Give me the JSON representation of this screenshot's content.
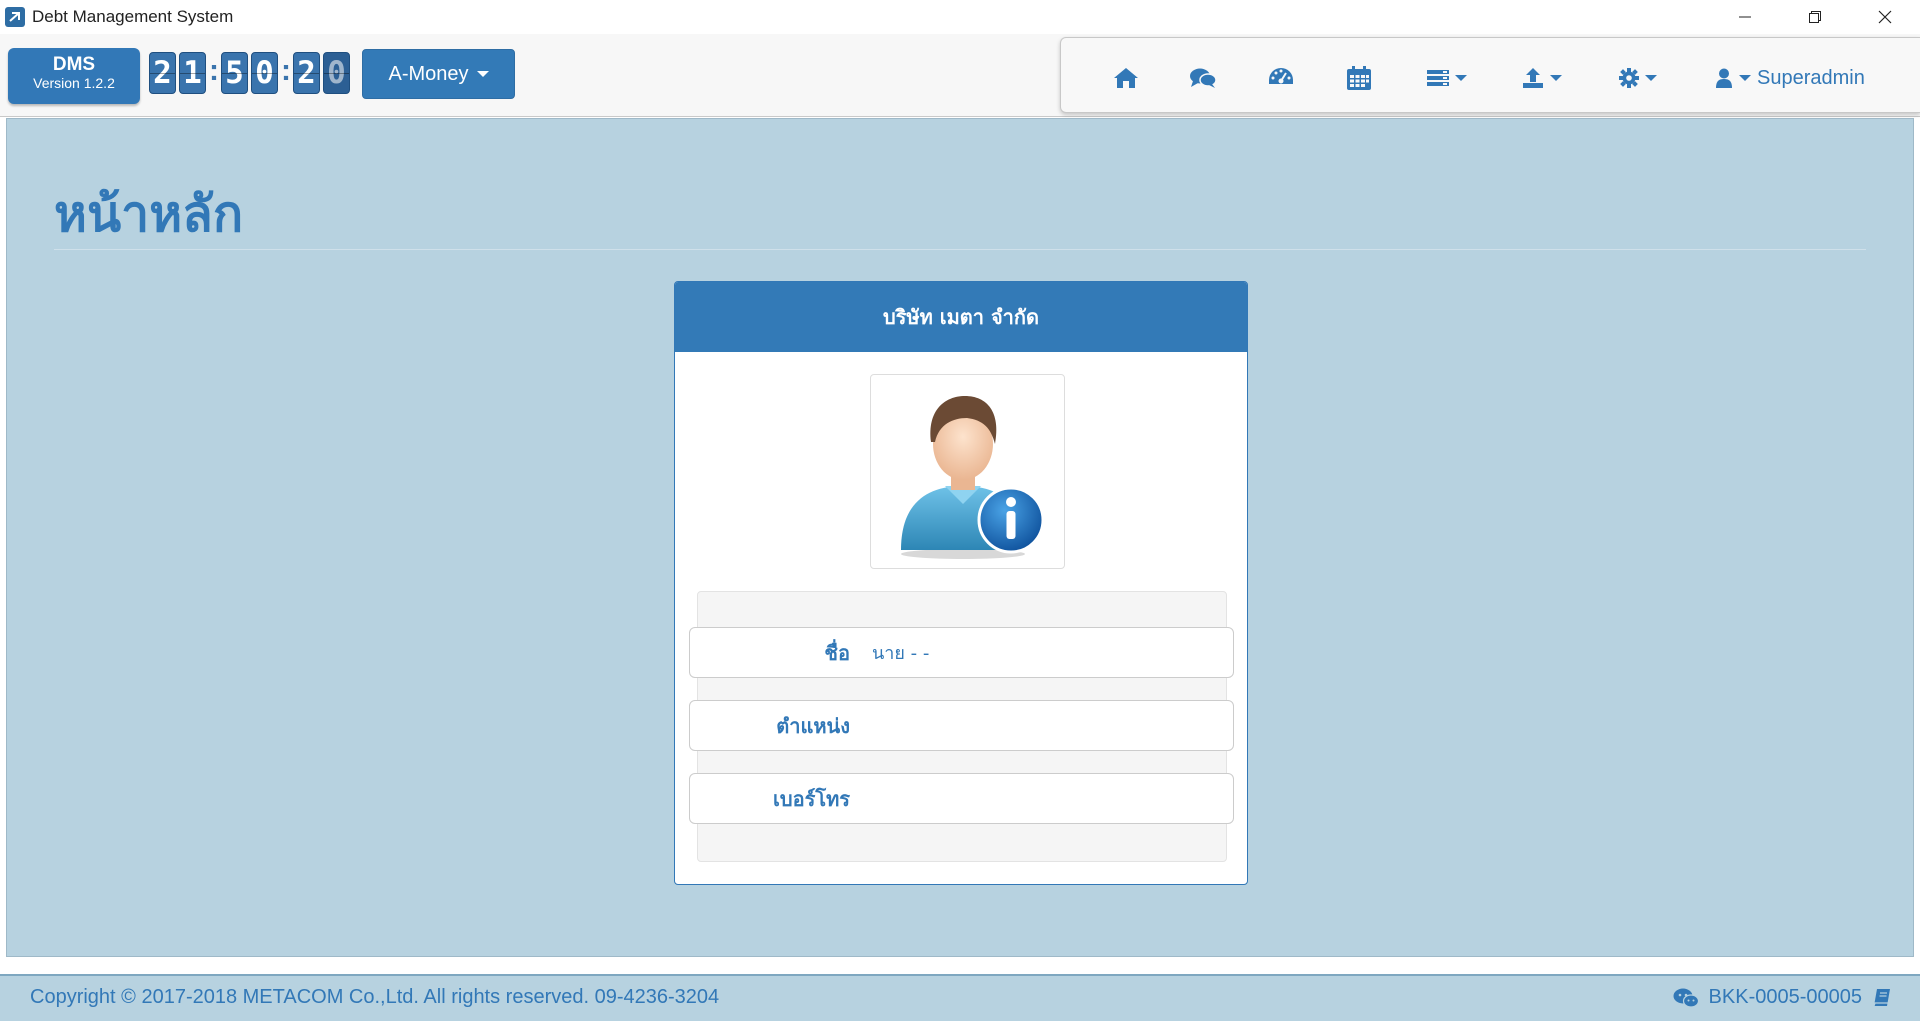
{
  "window": {
    "title": "Debt Management System",
    "controls": [
      "minimize-icon",
      "restore-icon",
      "close-icon"
    ]
  },
  "brand": {
    "name": "DMS",
    "version": "Version 1.2.2"
  },
  "clock": {
    "digits": [
      "2",
      "1",
      "5",
      "0",
      "2",
      "0"
    ],
    "display": "21:50:20"
  },
  "company_menu": {
    "label": "A-Money"
  },
  "nav": {
    "items": [
      {
        "icon": "home-icon"
      },
      {
        "icon": "chat-icon"
      },
      {
        "icon": "dashboard-icon"
      },
      {
        "icon": "calendar-icon"
      },
      {
        "icon": "list-icon",
        "dropdown": true
      },
      {
        "icon": "upload-icon",
        "dropdown": true
      },
      {
        "icon": "gear-icon",
        "dropdown": true
      }
    ],
    "user": {
      "icon": "user-icon",
      "label": "Superadmin"
    }
  },
  "page": {
    "title": "หน้าหลัก"
  },
  "profile_card": {
    "company": "บริษัท เมตา จำกัด",
    "avatar_icon": "user-info-avatar-icon",
    "rows": [
      {
        "label": "ชื่อ",
        "value": "นาย - -"
      },
      {
        "label": "ตำแหน่ง",
        "value": ""
      },
      {
        "label": "เบอร์โทร",
        "value": ""
      }
    ]
  },
  "footer": {
    "copyright": "Copyright © 2017-2018 METACOM Co.,Ltd. All rights reserved. 09-4236-3204",
    "code": "BKK-0005-00005",
    "left_icon": "wechat-icon",
    "right_icon": "book-icon"
  },
  "colors": {
    "primary": "#337ab7",
    "background": "#b7d2e0"
  }
}
